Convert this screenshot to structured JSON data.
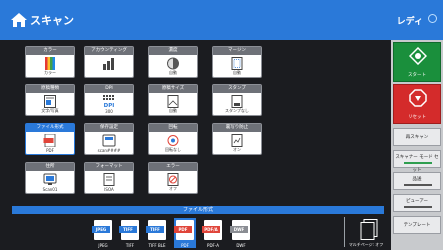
{
  "header": {
    "title": "スキャン",
    "status": "レディ"
  },
  "settings": [
    {
      "caption": "カラー",
      "value": "カラー",
      "icon": "color-palette-icon",
      "active": false
    },
    {
      "caption": "アカウンティング",
      "value": "",
      "icon": "accounting-icon",
      "active": false
    },
    {
      "caption": "濃度",
      "value": "自動",
      "icon": "density-icon",
      "active": false
    },
    {
      "caption": "マージン",
      "value": "自動",
      "icon": "margin-icon",
      "active": false
    },
    {
      "caption": "原稿種類",
      "value": "文字/写真",
      "icon": "document-type-icon",
      "active": false
    },
    {
      "caption": "DPI",
      "value": "300",
      "icon": "dpi-icon",
      "active": false
    },
    {
      "caption": "原稿サイズ",
      "value": "自動",
      "icon": "page-size-icon",
      "active": false
    },
    {
      "caption": "スタンプ",
      "value": "スタンプなし",
      "icon": "stamp-icon",
      "active": false
    },
    {
      "caption": "ファイル形式",
      "value": "PDF",
      "icon": "pdf-icon",
      "active": true
    },
    {
      "caption": "保存設定",
      "value": "scan####",
      "icon": "save-settings-icon",
      "active": false
    },
    {
      "caption": "回転",
      "value": "回転なし",
      "icon": "rotate-icon",
      "active": false
    },
    {
      "caption": "裏写り防止",
      "value": "オン",
      "icon": "bleed-through-icon",
      "active": false
    },
    {
      "caption": "住所",
      "value": "Scan01",
      "icon": "address-icon",
      "active": false
    },
    {
      "caption": "フォーマット",
      "value": "ISOA",
      "icon": "format-icon",
      "active": false
    },
    {
      "caption": "エラー",
      "value": "オフ",
      "icon": "error-icon",
      "active": false
    }
  ],
  "right_panel": {
    "start": "スタート",
    "reset": "リセット",
    "buttons": [
      "再スキャン",
      "スキャナー モード セット",
      "品送",
      "ピューアー",
      "テンプレート"
    ]
  },
  "file_format": {
    "header": "ファイル形式",
    "formats": [
      {
        "tag": "JPEG",
        "label": "JPEG",
        "color": "#2a79d9",
        "selected": false
      },
      {
        "tag": "TIFF",
        "label": "TIFF",
        "color": "#2a79d9",
        "selected": false
      },
      {
        "tag": "TIFF",
        "label": "TIFF BLE",
        "color": "#2a79d9",
        "selected": false
      },
      {
        "tag": "PDF",
        "label": "PDF",
        "color": "#e0453a",
        "selected": true
      },
      {
        "tag": "PDF/A",
        "label": "PDF-A",
        "color": "#e0453a",
        "selected": false
      },
      {
        "tag": "DWF",
        "label": "DWF",
        "color": "#8a8d93",
        "selected": false
      }
    ],
    "multipage_label": "マルチページ: オフ"
  },
  "colors": {
    "accent": "#2a79d9",
    "start_green": "#1a8f3c",
    "reset_red": "#d42b2b",
    "background": "#1b1c20"
  }
}
